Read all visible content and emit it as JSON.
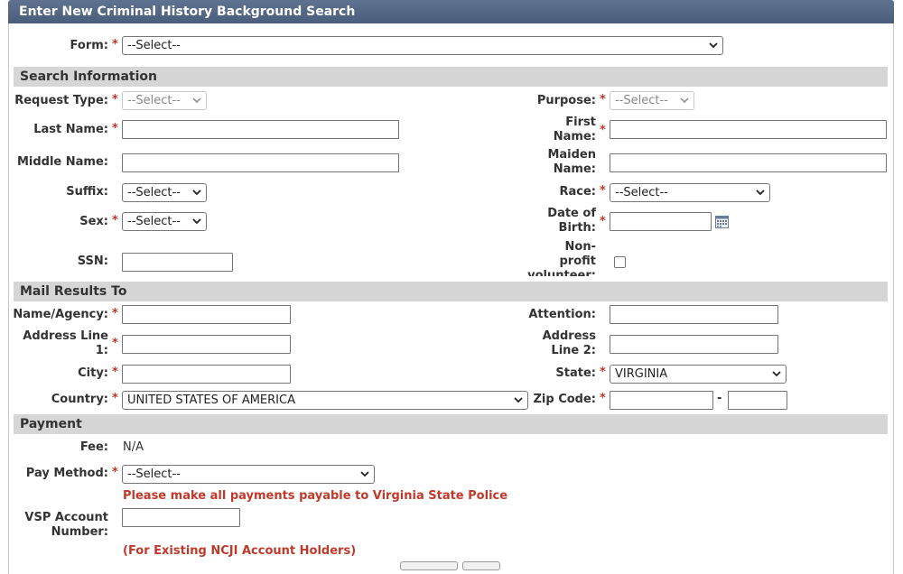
{
  "title": "Enter New Criminal History Background Search",
  "form": {
    "label": "Form:",
    "value": "--Select--"
  },
  "sections": {
    "search": "Search Information",
    "mail": "Mail Results To",
    "payment": "Payment"
  },
  "search": {
    "request_type": {
      "label": "Request Type:",
      "value": "--Select--"
    },
    "purpose": {
      "label": "Purpose:",
      "value": "--Select--"
    },
    "last_name": {
      "label": "Last Name:"
    },
    "first_name": {
      "label_line1": "First",
      "label_line2": "Name:"
    },
    "middle_name": {
      "label": "Middle Name:"
    },
    "maiden_name": {
      "label_line1": "Maiden",
      "label_line2": "Name:"
    },
    "suffix": {
      "label": "Suffix:",
      "value": "--Select--"
    },
    "race": {
      "label": "Race:",
      "value": "--Select--"
    },
    "sex": {
      "label": "Sex:",
      "value": "--Select--"
    },
    "dob": {
      "label_line1": "Date of",
      "label_line2": "Birth:"
    },
    "ssn": {
      "label": "SSN:"
    },
    "nonprofit": {
      "label_line1": "Non-",
      "label_line2": "profit",
      "label_line3": "volunteer:"
    }
  },
  "mail": {
    "name_agency": {
      "label": "Name/Agency:"
    },
    "attention": {
      "label": "Attention:"
    },
    "address1": {
      "label_line1": "Address Line",
      "label_line2": "1:"
    },
    "address2": {
      "label_line1": "Address",
      "label_line2": "Line 2:"
    },
    "city": {
      "label": "City:"
    },
    "state": {
      "label": "State:",
      "value": "VIRGINIA"
    },
    "country": {
      "label": "Country:",
      "value": "UNITED STATES OF AMERICA"
    },
    "zip": {
      "label": "Zip Code:",
      "separator": "-"
    }
  },
  "payment": {
    "fee": {
      "label": "Fee:",
      "value": "N/A"
    },
    "pay_method": {
      "label": "Pay Method:",
      "value": "--Select--"
    },
    "notice": "Please make all payments payable to Virginia State Police",
    "vsp_account": {
      "label_line1": "VSP Account",
      "label_line2": "Number:"
    },
    "account_note": "(For Existing NCJI Account Holders)"
  },
  "required_mark": "*",
  "colors": {
    "titlebar": "#4f6380",
    "section": "#d6d6d6",
    "required": "#c0392b"
  }
}
